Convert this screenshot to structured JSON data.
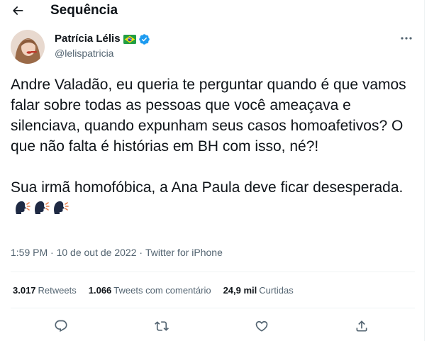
{
  "header": {
    "title": "Sequência",
    "back_icon": "arrow-left-icon"
  },
  "author": {
    "name": "Patrícia Lélis",
    "flag": "brazil-flag-icon",
    "verified_icon": "verified-badge-icon",
    "handle": "@lelispatricia",
    "more_icon": "more-horizontal-icon"
  },
  "tweet": {
    "text": "Andre Valadão, eu queria te perguntar quando é que vamos falar sobre todas as pessoas que você ameaçava e silenciava, quando expunham seus casos homoafetivos? O que não falta é histórias em BH com isso, né?!\n\nSua irmã homofóbica, a Ana Paula deve ficar desesperada.",
    "emojis": [
      "speaking-head-emoji",
      "speaking-head-emoji",
      "speaking-head-emoji"
    ]
  },
  "meta": {
    "time": "1:59 PM",
    "separator1": " · ",
    "date": "10 de out de 2022",
    "separator2": " · ",
    "source": "Twitter for iPhone"
  },
  "stats": {
    "retweets_count": "3.017",
    "retweets_label": "Retweets",
    "quotes_count": "1.066",
    "quotes_label": "Tweets com comentário",
    "likes_count": "24,9 mil",
    "likes_label": "Curtidas"
  },
  "actions": [
    "reply-icon",
    "retweet-icon",
    "like-icon",
    "share-icon"
  ],
  "colors": {
    "text": "#0f1419",
    "secondary": "#536471",
    "verified": "#1d9bf0",
    "border": "#eff3f4"
  }
}
